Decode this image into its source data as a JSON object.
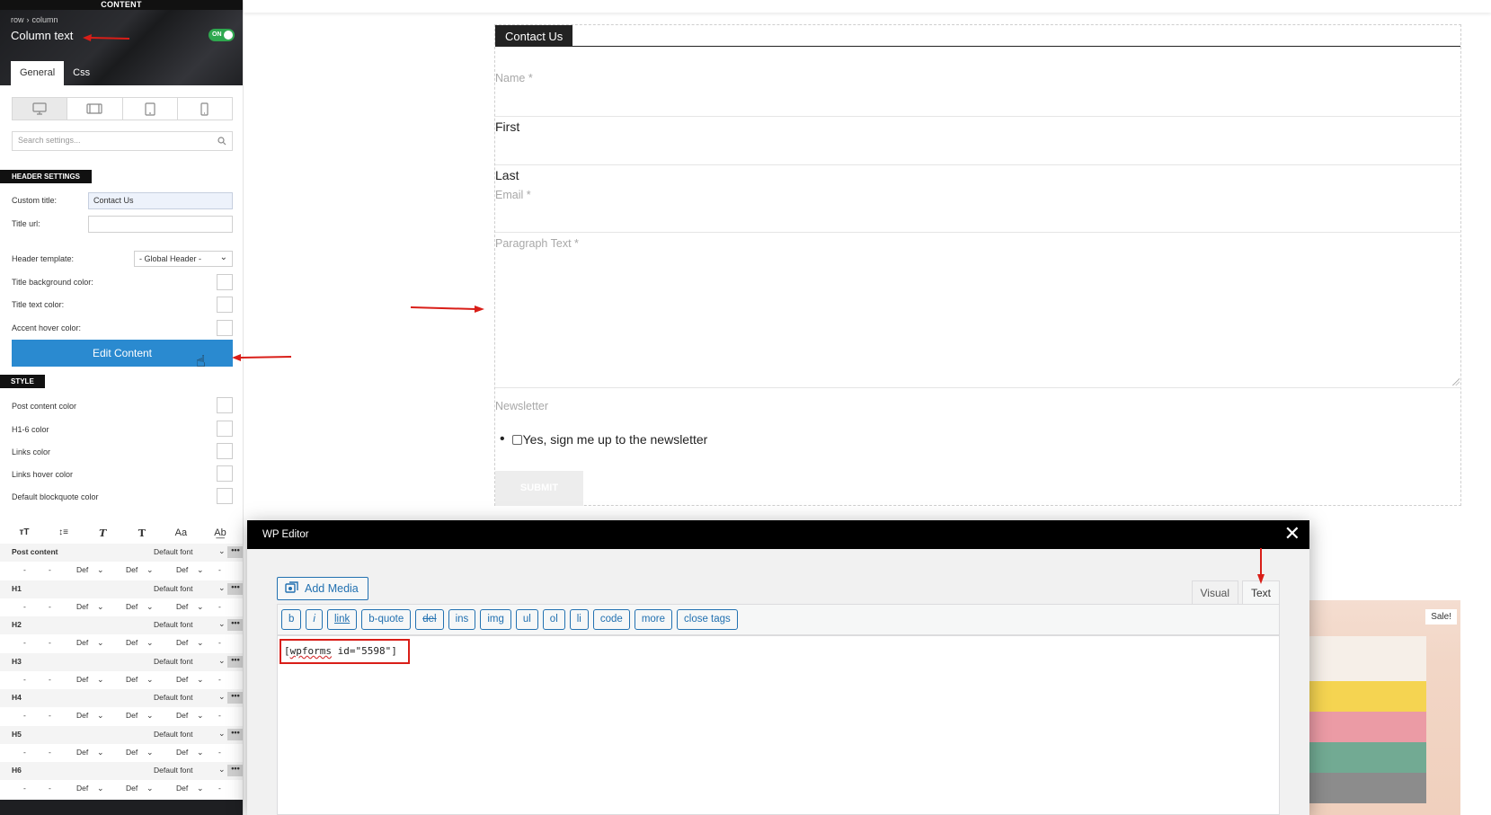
{
  "panel": {
    "section_label": "CONTENT",
    "breadcrumb": [
      "row",
      "column"
    ],
    "title": "Column text",
    "toggle_label": "ON",
    "tabs": [
      "General",
      "Css"
    ],
    "search_placeholder": "Search settings...",
    "header_settings": {
      "tag": "HEADER SETTINGS",
      "custom_title_label": "Custom title:",
      "custom_title_value": "Contact Us",
      "title_url_label": "Title url:",
      "title_url_value": "",
      "header_template_label": "Header template:",
      "header_template_value": "- Global Header -",
      "title_bg_label": "Title background color:",
      "title_text_label": "Title text color:",
      "accent_hover_label": "Accent hover color:"
    },
    "edit_content_label": "Edit Content",
    "style": {
      "tag": "STYLE",
      "items": [
        "Post content color",
        "H1-6 color",
        "Links color",
        "Links hover color",
        "Default blockquote color"
      ]
    },
    "typography": {
      "icons": [
        "font-size-icon",
        "line-height-icon",
        "italic-icon",
        "bold-icon",
        "font-case-icon",
        "letter-spacing-icon"
      ],
      "icon_glyphs": [
        "ᴛT",
        "↕≡",
        "T",
        "T",
        "Aa",
        "A͟b"
      ],
      "rows": [
        {
          "name": "Post content",
          "font": "Default font"
        },
        {
          "name": "H1",
          "font": "Default font"
        },
        {
          "name": "H2",
          "font": "Default font"
        },
        {
          "name": "H3",
          "font": "Default font"
        },
        {
          "name": "H4",
          "font": "Default font"
        },
        {
          "name": "H5",
          "font": "Default font"
        },
        {
          "name": "H6",
          "font": "Default font"
        }
      ],
      "sub_values": [
        "-",
        "-",
        "Def",
        "Def",
        "Def",
        "-"
      ]
    }
  },
  "contact_form": {
    "title": "Contact Us",
    "name_label": "Name *",
    "first_label": "First",
    "last_label": "Last",
    "email_label": "Email *",
    "paragraph_label": "Paragraph Text *",
    "newsletter_label": "Newsletter",
    "newsletter_option": "Yes, sign me up to the newsletter",
    "submit_label": "SUBMIT"
  },
  "product": {
    "badge": "Sale!"
  },
  "wp_editor": {
    "title": "WP Editor",
    "add_media_label": "Add Media",
    "tabs": [
      "Visual",
      "Text"
    ],
    "active_tab": "Text",
    "quicktags": [
      "b",
      "i",
      "link",
      "b-quote",
      "del",
      "ins",
      "img",
      "ul",
      "ol",
      "li",
      "code",
      "more",
      "close tags"
    ],
    "content_tag": "wpforms",
    "content_rest": " id=\"5598\"]"
  },
  "colors": {
    "accent_blue": "#2a8ad0",
    "toggle_green": "#2fa84f",
    "annotation_red": "#d91e18",
    "wp_link_blue": "#2271b1"
  }
}
